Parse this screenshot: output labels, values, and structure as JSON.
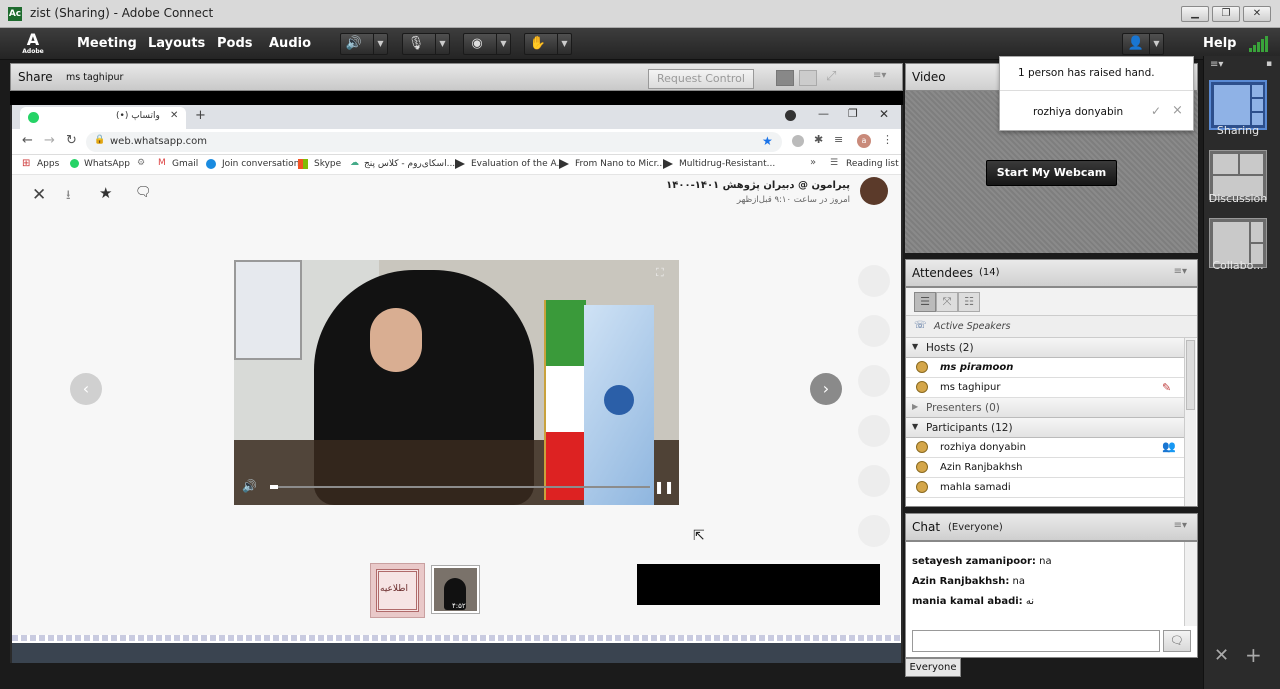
{
  "window": {
    "title": "zist (Sharing) - Adobe Connect",
    "app_icon": "connect-icon"
  },
  "menubar": {
    "logo": "Adobe",
    "items": [
      "Meeting",
      "Layouts",
      "Pods",
      "Audio"
    ],
    "help": "Help"
  },
  "share": {
    "title": "Share",
    "presenter": "ms taghipur",
    "request_control": "Request Control"
  },
  "browser": {
    "tab_title": "(•) واتساپ",
    "url": "web.whatsapp.com",
    "bookmarks": [
      "Apps",
      "WhatsApp",
      "Gmail",
      "Join conversation",
      "Skype",
      "اسکای‌روم - کلاس پنج...",
      "Evaluation of the A...",
      "From Nano to Micr...",
      "Multidrug-Resistant..."
    ],
    "reading_list": "Reading list",
    "more_bookmarks": "»"
  },
  "whatsapp": {
    "sender": "پیرامون @ دبیران پژوهش ۱۴۰۱-۱۴۰۰",
    "timestamp": "امروز در ساعت ۹:۱۰ قبل‌ازظهر",
    "thumb_label": "اطلاعیه",
    "thumb_duration": "۴:۵۲"
  },
  "video_pod": {
    "title": "Video",
    "start_webcam": "Start My Webcam"
  },
  "notification": {
    "raised_hand": "1 person has raised hand.",
    "name": "rozhiya donyabin",
    "accept": "✓",
    "dismiss": "×"
  },
  "attendees": {
    "title": "Attendees",
    "count": "(14)",
    "active_speakers": "Active Speakers",
    "hosts_label": "Hosts (2)",
    "hosts": [
      "ms piramoon",
      "ms taghipur"
    ],
    "presenters_label": "Presenters (0)",
    "participants_label": "Participants (12)",
    "participants": [
      "rozhiya donyabin",
      "Azin Ranjbakhsh",
      "mahla samadi"
    ]
  },
  "chat": {
    "title": "Chat",
    "scope": "(Everyone)",
    "messages": [
      {
        "sender": "setayesh zamanipoor:",
        "text": "na"
      },
      {
        "sender": "Azin Ranjbakhsh:",
        "text": "na"
      },
      {
        "sender": "mania kamal abadi:",
        "text": "نه"
      }
    ],
    "target": "Everyone"
  },
  "layouts": {
    "items": [
      "Sharing",
      "Discussion",
      "Collabo..."
    ]
  },
  "colors": {
    "accent": "#39a33a",
    "mic_active": "#45b52a",
    "raise_hand": "#c04040"
  }
}
